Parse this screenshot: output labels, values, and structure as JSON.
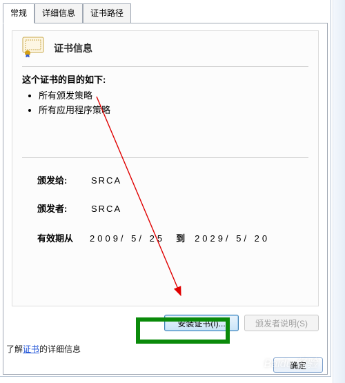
{
  "tabs": {
    "general": "常规",
    "details": "详细信息",
    "path": "证书路径"
  },
  "panel": {
    "header": "证书信息",
    "purpose_label": "这个证书的目的如下:",
    "purposes": [
      "所有颁发策略",
      "所有应用程序策略"
    ],
    "issued_to_label": "颁发给:",
    "issued_to_value": "SRCA",
    "issued_by_label": "颁发者:",
    "issued_by_value": "SRCA",
    "valid_from_label": "有效期从",
    "valid_from_value": "2009/ 5/ 25",
    "valid_to_label": "到",
    "valid_to_value": "2029/ 5/ 20"
  },
  "buttons": {
    "install": "安装证书(I)...",
    "statement": "颁发者说明(S)",
    "ok": "确定"
  },
  "link": {
    "prefix": "了解",
    "link_text": "证书",
    "suffix": "的详细信息"
  },
  "icons": {
    "certificate": "certificate-icon"
  },
  "watermark": "Baidu 经验"
}
